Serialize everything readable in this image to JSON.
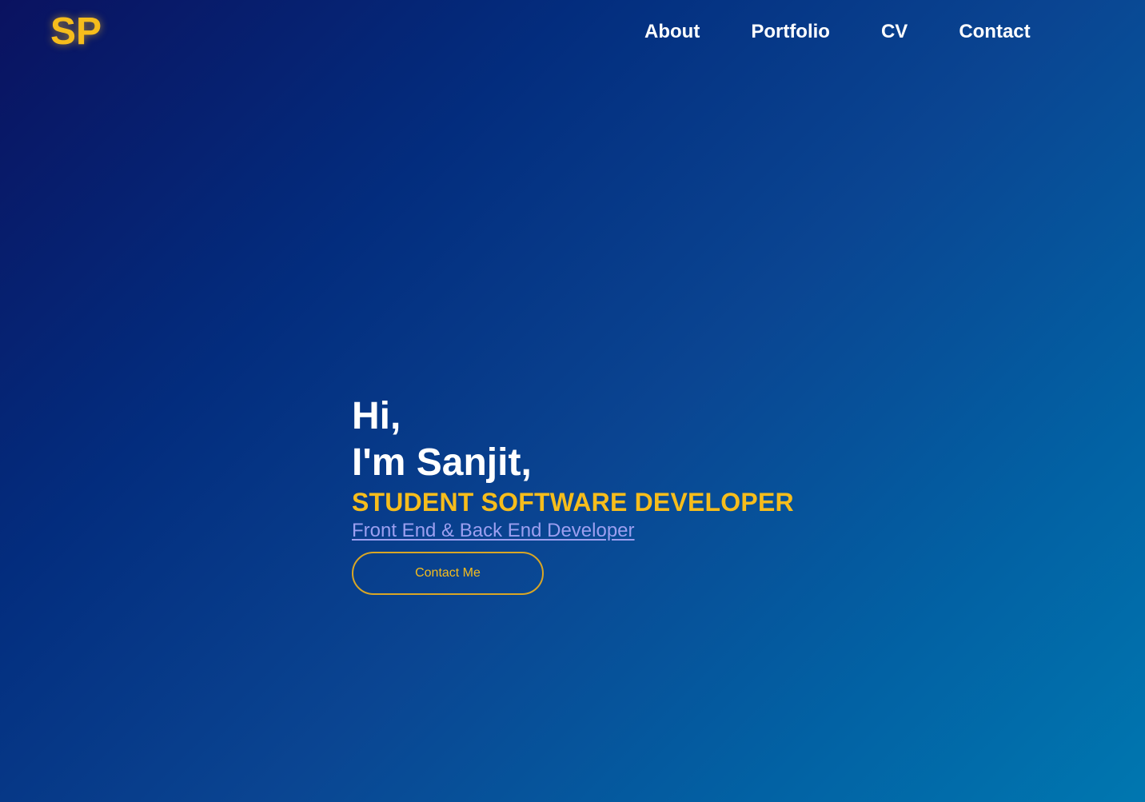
{
  "header": {
    "logo": "SP",
    "nav": [
      {
        "label": "About"
      },
      {
        "label": "Portfolio"
      },
      {
        "label": "CV"
      },
      {
        "label": "Contact"
      }
    ]
  },
  "hero": {
    "greeting_line1": "Hi,",
    "greeting_line2": "I'm Sanjit,",
    "role": "STUDENT SOFTWARE DEVELOPER",
    "subtitle": "Front End & Back End Developer",
    "cta_label": "Contact Me"
  },
  "colors": {
    "accent": "#f6bd1c",
    "link": "#9c9ff0",
    "text": "#ffffff",
    "background_start": "#0a1260",
    "background_end": "#0077b0"
  }
}
